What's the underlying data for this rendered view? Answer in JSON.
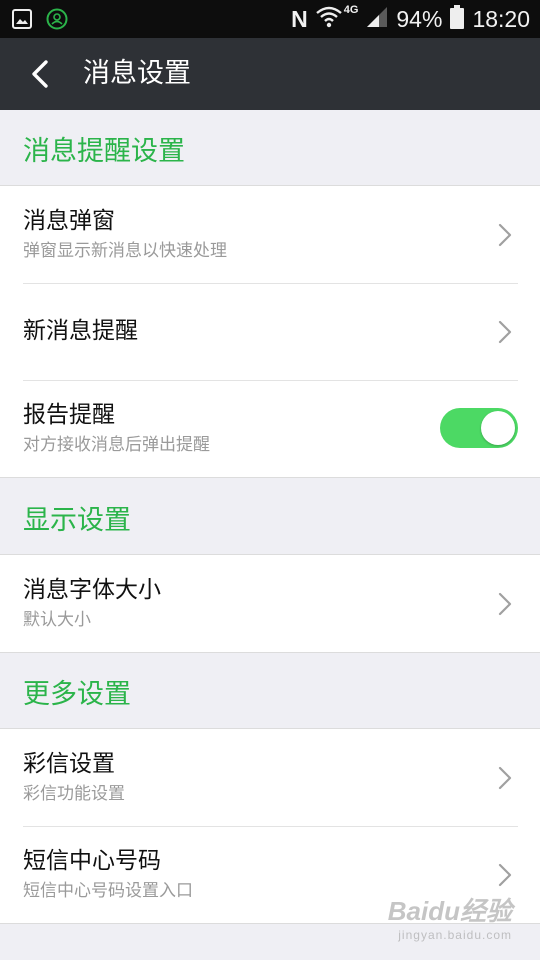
{
  "status_bar": {
    "battery": "94%",
    "time": "18:20",
    "network": "4G",
    "n_label": "N"
  },
  "header": {
    "title": "消息设置"
  },
  "sections": [
    {
      "title": "消息提醒设置",
      "items": [
        {
          "title": "消息弹窗",
          "subtitle": "弹窗显示新消息以快速处理",
          "control": "chevron"
        },
        {
          "title": "新消息提醒",
          "control": "chevron"
        },
        {
          "title": "报告提醒",
          "subtitle": "对方接收消息后弹出提醒",
          "control": "toggle",
          "toggle_on": true
        }
      ]
    },
    {
      "title": "显示设置",
      "items": [
        {
          "title": "消息字体大小",
          "subtitle": "默认大小",
          "control": "chevron"
        }
      ]
    },
    {
      "title": "更多设置",
      "items": [
        {
          "title": "彩信设置",
          "subtitle": "彩信功能设置",
          "control": "chevron"
        },
        {
          "title": "短信中心号码",
          "subtitle": "短信中心号码设置入口",
          "control": "chevron"
        }
      ]
    }
  ],
  "watermark": {
    "main": "Baidu经验",
    "sub": "jingyan.baidu.com"
  },
  "colors": {
    "accent_green": "#2bb44a",
    "toggle_green": "#4cd964",
    "navbar": "#2e3136",
    "statusbar": "#0d0d0d",
    "background": "#efeff4"
  }
}
